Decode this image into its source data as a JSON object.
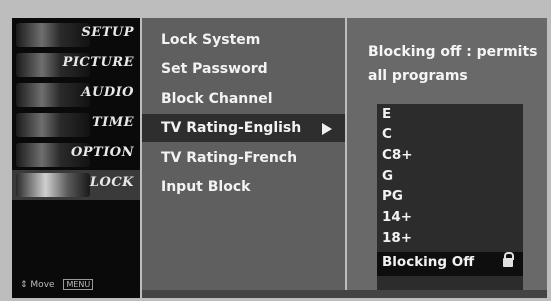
{
  "sidebar": {
    "items": [
      {
        "label": "SETUP"
      },
      {
        "label": "PICTURE"
      },
      {
        "label": "AUDIO"
      },
      {
        "label": "TIME"
      },
      {
        "label": "OPTION"
      },
      {
        "label": "LOCK"
      }
    ],
    "help_move": "Move",
    "help_key": "MENU"
  },
  "menu": {
    "items": [
      {
        "label": "Lock System"
      },
      {
        "label": "Set Password"
      },
      {
        "label": "Block Channel"
      },
      {
        "label": "TV Rating-English"
      },
      {
        "label": "TV Rating-French"
      },
      {
        "label": "Input Block"
      }
    ],
    "selected": "TV Rating-English"
  },
  "panel": {
    "info": "Blocking off : permits all programs",
    "options": [
      "E",
      "C",
      "C8+",
      "G",
      "PG",
      "14+",
      "18+"
    ],
    "selected_option": "Blocking Off",
    "selected_icon": "lock-icon"
  },
  "colors": {
    "menu_bg": "#5f5f5f",
    "panel_bg": "#696969",
    "selection_bg": "#2e2e2e"
  }
}
